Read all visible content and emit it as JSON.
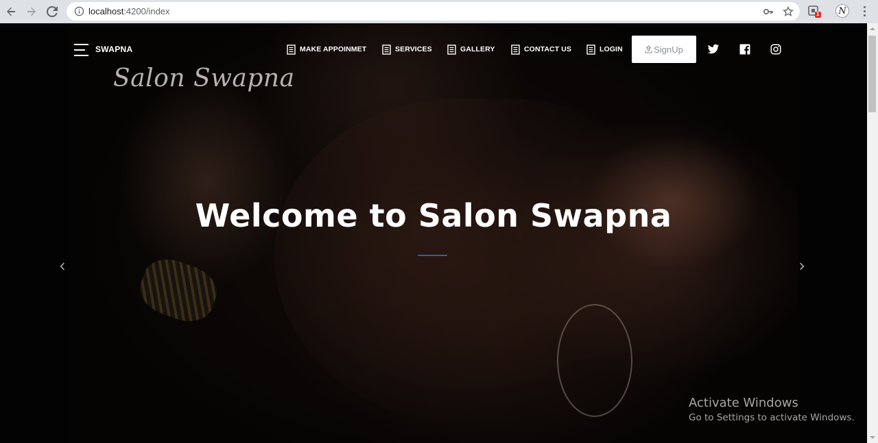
{
  "browser": {
    "url_host": "localhost",
    "url_path": ":4200/index",
    "extension_badge": "1",
    "profile_initial": "N"
  },
  "nav": {
    "brand": "SWAPNA",
    "logo_script": "Salon Swapna",
    "items": [
      {
        "label": "MAKE APPOINMET"
      },
      {
        "label": "SERVICES"
      },
      {
        "label": "GALLERY"
      },
      {
        "label": "CONTACT US"
      },
      {
        "label": "LOGIN"
      }
    ],
    "signup_label": "SignUp",
    "social": [
      "twitter-icon",
      "facebook-icon",
      "instagram-icon"
    ]
  },
  "hero": {
    "title": "Welcome to Salon Swapna",
    "accent_color": "#2e5fa6"
  },
  "watermark": {
    "line1": "Activate Windows",
    "line2": "Go to Settings to activate Windows."
  }
}
